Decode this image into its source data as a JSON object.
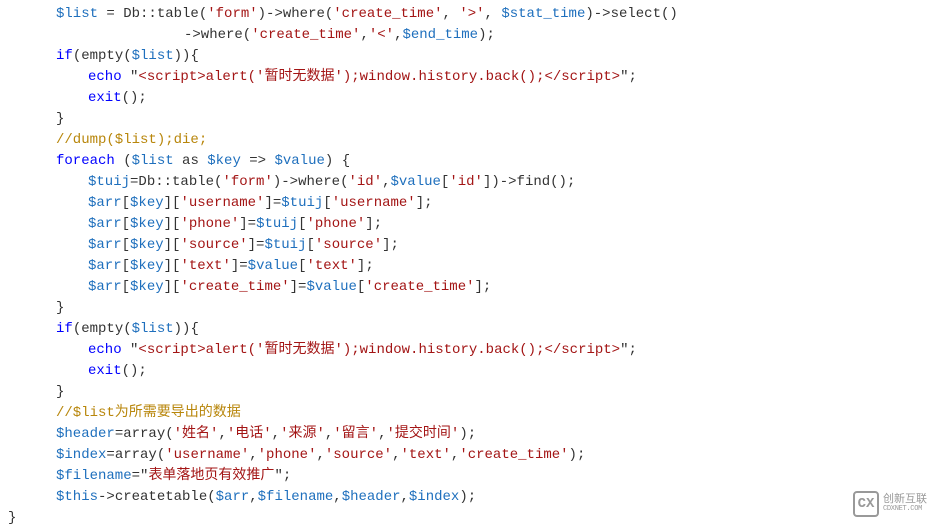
{
  "lines": [
    {
      "indent": "indent1",
      "segments": [
        {
          "c": "var",
          "t": "$list"
        },
        {
          "c": "op",
          "t": " = Db::table("
        },
        {
          "c": "str",
          "t": "'form'"
        },
        {
          "c": "op",
          "t": ")->where("
        },
        {
          "c": "str",
          "t": "'create_time'"
        },
        {
          "c": "op",
          "t": ", "
        },
        {
          "c": "str",
          "t": "'>'"
        },
        {
          "c": "op",
          "t": ", "
        },
        {
          "c": "var",
          "t": "$stat_time"
        },
        {
          "c": "op",
          "t": ")->select()"
        }
      ]
    },
    {
      "indent": "indent3",
      "segments": [
        {
          "c": "op",
          "t": "->where("
        },
        {
          "c": "str",
          "t": "'create_time'"
        },
        {
          "c": "op",
          "t": ","
        },
        {
          "c": "str",
          "t": "'<'"
        },
        {
          "c": "op",
          "t": ","
        },
        {
          "c": "var",
          "t": "$end_time"
        },
        {
          "c": "op",
          "t": ");"
        }
      ]
    },
    {
      "indent": "indent1",
      "segments": [
        {
          "c": "kw-blue",
          "t": "if"
        },
        {
          "c": "op",
          "t": "(empty("
        },
        {
          "c": "var",
          "t": "$list"
        },
        {
          "c": "op",
          "t": ")){"
        }
      ]
    },
    {
      "indent": "indent2",
      "segments": [
        {
          "c": "kw-blue",
          "t": "echo"
        },
        {
          "c": "op",
          "t": " \""
        },
        {
          "c": "str",
          "t": "<script>alert('暂时无数据');window.history.back();</script>"
        },
        {
          "c": "op",
          "t": "\";"
        }
      ]
    },
    {
      "indent": "indent2",
      "segments": [
        {
          "c": "kw-blue",
          "t": "exit"
        },
        {
          "c": "op",
          "t": "();"
        }
      ]
    },
    {
      "indent": "indent1",
      "segments": [
        {
          "c": "op",
          "t": "}"
        }
      ]
    },
    {
      "indent": "indent1",
      "segments": [
        {
          "c": "comment-orange",
          "t": "//dump($list);die;"
        }
      ]
    },
    {
      "indent": "indent1",
      "segments": [
        {
          "c": "kw-blue",
          "t": "foreach"
        },
        {
          "c": "op",
          "t": " ("
        },
        {
          "c": "var",
          "t": "$list"
        },
        {
          "c": "op",
          "t": " as "
        },
        {
          "c": "var",
          "t": "$key"
        },
        {
          "c": "op",
          "t": " => "
        },
        {
          "c": "var",
          "t": "$value"
        },
        {
          "c": "op",
          "t": ") {"
        }
      ]
    },
    {
      "indent": "indent2",
      "segments": [
        {
          "c": "var",
          "t": "$tuij"
        },
        {
          "c": "op",
          "t": "=Db::table("
        },
        {
          "c": "str",
          "t": "'form'"
        },
        {
          "c": "op",
          "t": ")->where("
        },
        {
          "c": "str",
          "t": "'id'"
        },
        {
          "c": "op",
          "t": ","
        },
        {
          "c": "var",
          "t": "$value"
        },
        {
          "c": "op",
          "t": "["
        },
        {
          "c": "str",
          "t": "'id'"
        },
        {
          "c": "op",
          "t": "])->find();"
        }
      ]
    },
    {
      "indent": "indent2",
      "segments": [
        {
          "c": "var",
          "t": "$arr"
        },
        {
          "c": "op",
          "t": "["
        },
        {
          "c": "var",
          "t": "$key"
        },
        {
          "c": "op",
          "t": "]["
        },
        {
          "c": "str",
          "t": "'username'"
        },
        {
          "c": "op",
          "t": "]="
        },
        {
          "c": "var",
          "t": "$tuij"
        },
        {
          "c": "op",
          "t": "["
        },
        {
          "c": "str",
          "t": "'username'"
        },
        {
          "c": "op",
          "t": "];"
        }
      ]
    },
    {
      "indent": "indent2",
      "segments": [
        {
          "c": "var",
          "t": "$arr"
        },
        {
          "c": "op",
          "t": "["
        },
        {
          "c": "var",
          "t": "$key"
        },
        {
          "c": "op",
          "t": "]["
        },
        {
          "c": "str",
          "t": "'phone'"
        },
        {
          "c": "op",
          "t": "]="
        },
        {
          "c": "var",
          "t": "$tuij"
        },
        {
          "c": "op",
          "t": "["
        },
        {
          "c": "str",
          "t": "'phone'"
        },
        {
          "c": "op",
          "t": "];"
        }
      ]
    },
    {
      "indent": "indent2",
      "segments": [
        {
          "c": "var",
          "t": "$arr"
        },
        {
          "c": "op",
          "t": "["
        },
        {
          "c": "var",
          "t": "$key"
        },
        {
          "c": "op",
          "t": "]["
        },
        {
          "c": "str",
          "t": "'source'"
        },
        {
          "c": "op",
          "t": "]="
        },
        {
          "c": "var",
          "t": "$tuij"
        },
        {
          "c": "op",
          "t": "["
        },
        {
          "c": "str",
          "t": "'source'"
        },
        {
          "c": "op",
          "t": "];"
        }
      ]
    },
    {
      "indent": "indent2",
      "segments": [
        {
          "c": "var",
          "t": "$arr"
        },
        {
          "c": "op",
          "t": "["
        },
        {
          "c": "var",
          "t": "$key"
        },
        {
          "c": "op",
          "t": "]["
        },
        {
          "c": "str",
          "t": "'text'"
        },
        {
          "c": "op",
          "t": "]="
        },
        {
          "c": "var",
          "t": "$value"
        },
        {
          "c": "op",
          "t": "["
        },
        {
          "c": "str",
          "t": "'text'"
        },
        {
          "c": "op",
          "t": "];"
        }
      ]
    },
    {
      "indent": "indent2",
      "segments": [
        {
          "c": "var",
          "t": "$arr"
        },
        {
          "c": "op",
          "t": "["
        },
        {
          "c": "var",
          "t": "$key"
        },
        {
          "c": "op",
          "t": "]["
        },
        {
          "c": "str",
          "t": "'create_time'"
        },
        {
          "c": "op",
          "t": "]="
        },
        {
          "c": "var",
          "t": "$value"
        },
        {
          "c": "op",
          "t": "["
        },
        {
          "c": "str",
          "t": "'create_time'"
        },
        {
          "c": "op",
          "t": "];"
        }
      ]
    },
    {
      "indent": "indent1",
      "segments": [
        {
          "c": "op",
          "t": "}"
        }
      ]
    },
    {
      "indent": "indent1",
      "segments": [
        {
          "c": "kw-blue",
          "t": "if"
        },
        {
          "c": "op",
          "t": "(empty("
        },
        {
          "c": "var",
          "t": "$list"
        },
        {
          "c": "op",
          "t": ")){"
        }
      ]
    },
    {
      "indent": "indent2",
      "segments": [
        {
          "c": "kw-blue",
          "t": "echo"
        },
        {
          "c": "op",
          "t": " \""
        },
        {
          "c": "str",
          "t": "<script>alert('暂时无数据');window.history.back();</script>"
        },
        {
          "c": "op",
          "t": "\";"
        }
      ]
    },
    {
      "indent": "indent2",
      "segments": [
        {
          "c": "kw-blue",
          "t": "exit"
        },
        {
          "c": "op",
          "t": "();"
        }
      ]
    },
    {
      "indent": "indent1",
      "segments": [
        {
          "c": "op",
          "t": "}"
        }
      ]
    },
    {
      "indent": "indent1",
      "segments": [
        {
          "c": "comment-orange",
          "t": "//$list为所需要导出的数据"
        }
      ]
    },
    {
      "indent": "indent1",
      "segments": [
        {
          "c": "var",
          "t": "$header"
        },
        {
          "c": "op",
          "t": "=array("
        },
        {
          "c": "str",
          "t": "'姓名'"
        },
        {
          "c": "op",
          "t": ","
        },
        {
          "c": "str",
          "t": "'电话'"
        },
        {
          "c": "op",
          "t": ","
        },
        {
          "c": "str",
          "t": "'来源'"
        },
        {
          "c": "op",
          "t": ","
        },
        {
          "c": "str",
          "t": "'留言'"
        },
        {
          "c": "op",
          "t": ","
        },
        {
          "c": "str",
          "t": "'提交时间'"
        },
        {
          "c": "op",
          "t": ");"
        }
      ]
    },
    {
      "indent": "indent1",
      "segments": [
        {
          "c": "var",
          "t": "$index"
        },
        {
          "c": "op",
          "t": "=array("
        },
        {
          "c": "str",
          "t": "'username'"
        },
        {
          "c": "op",
          "t": ","
        },
        {
          "c": "str",
          "t": "'phone'"
        },
        {
          "c": "op",
          "t": ","
        },
        {
          "c": "str",
          "t": "'source'"
        },
        {
          "c": "op",
          "t": ","
        },
        {
          "c": "str",
          "t": "'text'"
        },
        {
          "c": "op",
          "t": ","
        },
        {
          "c": "str",
          "t": "'create_time'"
        },
        {
          "c": "op",
          "t": ");"
        }
      ]
    },
    {
      "indent": "indent1",
      "segments": [
        {
          "c": "var",
          "t": "$filename"
        },
        {
          "c": "op",
          "t": "=\""
        },
        {
          "c": "str",
          "t": "表单落地页有效推广"
        },
        {
          "c": "op",
          "t": "\";"
        }
      ]
    },
    {
      "indent": "indent1",
      "segments": [
        {
          "c": "var",
          "t": "$this"
        },
        {
          "c": "op",
          "t": "->createtable("
        },
        {
          "c": "var",
          "t": "$arr"
        },
        {
          "c": "op",
          "t": ","
        },
        {
          "c": "var",
          "t": "$filename"
        },
        {
          "c": "op",
          "t": ","
        },
        {
          "c": "var",
          "t": "$header"
        },
        {
          "c": "op",
          "t": ","
        },
        {
          "c": "var",
          "t": "$index"
        },
        {
          "c": "op",
          "t": ");"
        }
      ]
    },
    {
      "indent": "",
      "segments": [
        {
          "c": "op",
          "t": "}"
        }
      ]
    }
  ],
  "logo": {
    "symbol": "CX",
    "cn": "创新互联",
    "en": "CDXNET.COM"
  }
}
